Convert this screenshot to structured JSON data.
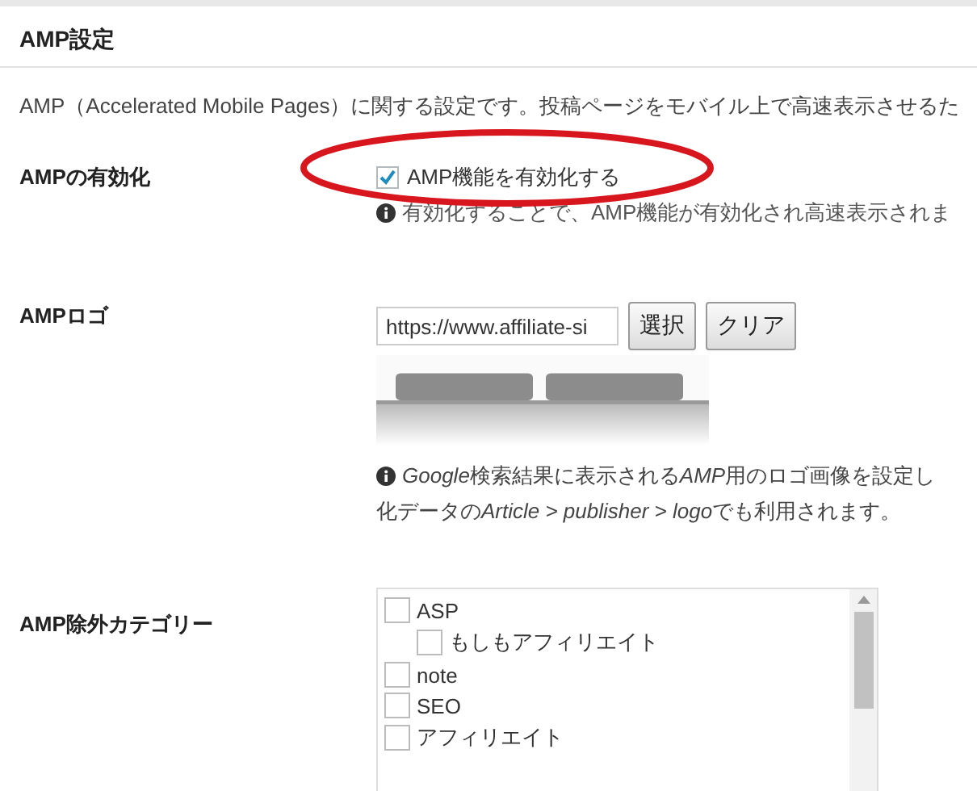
{
  "section_title": "AMP設定",
  "description": "AMP（Accelerated Mobile Pages）に関する設定です。投稿ページをモバイル上で高速表示させるた",
  "enable": {
    "label": "AMPの有効化",
    "checkbox_label": "AMP機能を有効化する",
    "checked": true,
    "circled": true,
    "help": "有効化することで、AMP機能が有効化され高速表示されま"
  },
  "logo": {
    "label": "AMPロゴ",
    "url_value": "https://www.affiliate-si",
    "buttons": [
      "選択",
      "クリア"
    ],
    "preview": {
      "kind": "picture"
    },
    "help_lines": [
      [
        {
          "text": "Google",
          "italic": true
        },
        {
          "text": "検索結果に表示される",
          "italic": false
        },
        {
          "text": "AMP",
          "italic": true
        },
        {
          "text": "用のロゴ画像を設定し",
          "italic": false
        }
      ],
      [
        {
          "text": "化データの",
          "italic": false
        },
        {
          "text": "Article > publisher > logo",
          "italic": true
        },
        {
          "text": "でも利用されます。",
          "italic": false
        }
      ]
    ]
  },
  "exclude": {
    "label": "AMP除外カテゴリー",
    "categories": [
      {
        "name": "ASP",
        "checked": false,
        "children": [
          {
            "name": "もしもアフィリエイト",
            "checked": false
          }
        ]
      },
      {
        "name": "note",
        "checked": false
      },
      {
        "name": "SEO",
        "checked": false
      },
      {
        "name": "アフィリエイト",
        "checked": false
      }
    ]
  }
}
